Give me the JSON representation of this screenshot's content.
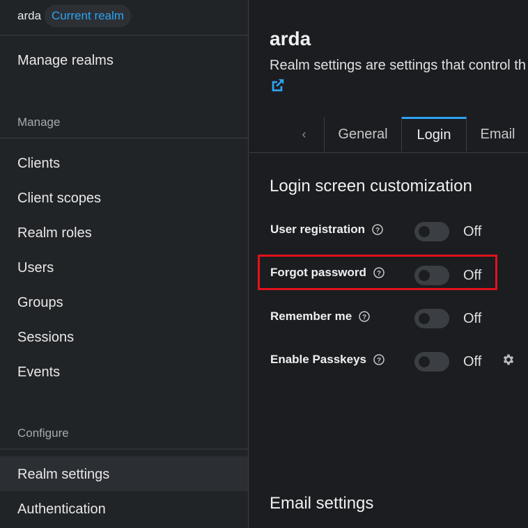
{
  "sidebar": {
    "realm_name": "arda",
    "realm_badge": "Current realm",
    "manage_realms": "Manage realms",
    "section_manage": "Manage",
    "items_manage": [
      "Clients",
      "Client scopes",
      "Realm roles",
      "Users",
      "Groups",
      "Sessions",
      "Events"
    ],
    "section_configure": "Configure",
    "items_configure": [
      "Realm settings",
      "Authentication"
    ]
  },
  "main": {
    "title": "arda",
    "description": "Realm settings are settings that control th",
    "tabs": [
      "General",
      "Login",
      "Email"
    ],
    "active_tab": "Login",
    "login_section_title": "Login screen customization",
    "fields": [
      {
        "label": "User registration",
        "state": "Off"
      },
      {
        "label": "Forgot password",
        "state": "Off"
      },
      {
        "label": "Remember me",
        "state": "Off"
      },
      {
        "label": "Enable Passkeys",
        "state": "Off"
      }
    ],
    "email_section_title": "Email settings"
  },
  "colors": {
    "accent": "#2ea3f2",
    "highlight": "#e3121b",
    "background": "#1b1d21",
    "sidebar": "#212427"
  }
}
